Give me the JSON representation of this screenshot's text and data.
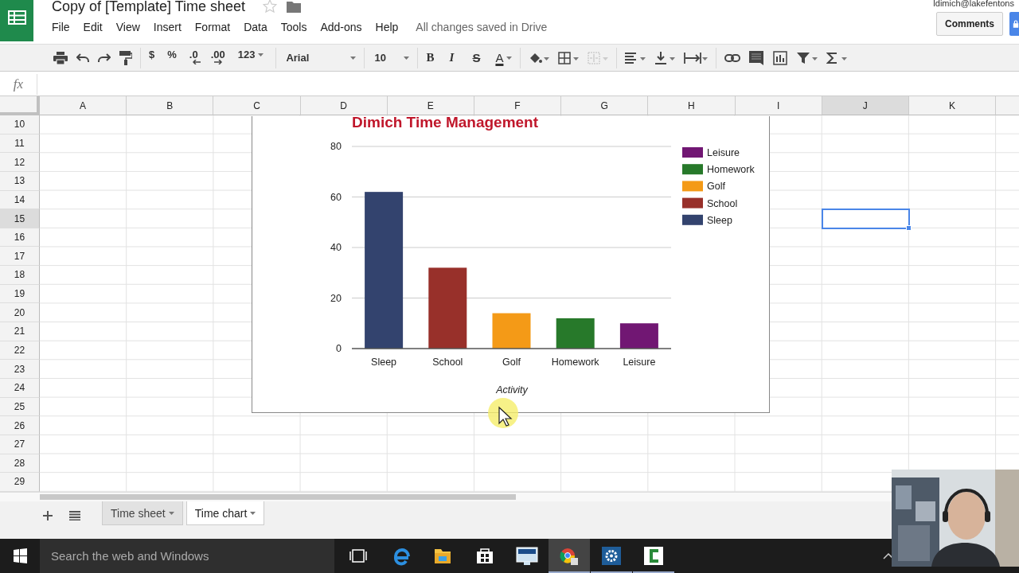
{
  "app": {
    "title": "Copy of [Template] Time sheet",
    "account": "ldimich@lakefentons",
    "save_status": "All changes saved in Drive",
    "comments_button": "Comments"
  },
  "menu": [
    "File",
    "Edit",
    "View",
    "Insert",
    "Format",
    "Data",
    "Tools",
    "Add-ons",
    "Help"
  ],
  "toolbar": {
    "number_formats": [
      "$",
      "%",
      ".0",
      ".00",
      "123"
    ],
    "font": "Arial",
    "font_size": "10",
    "text_styles": [
      "B",
      "I",
      "S",
      "A"
    ]
  },
  "formula_bar": {
    "label": "fx"
  },
  "columns": [
    {
      "label": "A",
      "selected": false
    },
    {
      "label": "B",
      "selected": false
    },
    {
      "label": "C",
      "selected": false
    },
    {
      "label": "D",
      "selected": false
    },
    {
      "label": "E",
      "selected": false
    },
    {
      "label": "F",
      "selected": false
    },
    {
      "label": "G",
      "selected": false
    },
    {
      "label": "H",
      "selected": false
    },
    {
      "label": "I",
      "selected": false
    },
    {
      "label": "J",
      "selected": true
    },
    {
      "label": "K",
      "selected": false
    }
  ],
  "rows": [
    {
      "label": "10",
      "selected": false
    },
    {
      "label": "11",
      "selected": false
    },
    {
      "label": "12",
      "selected": false
    },
    {
      "label": "13",
      "selected": false
    },
    {
      "label": "14",
      "selected": false
    },
    {
      "label": "15",
      "selected": true
    },
    {
      "label": "16",
      "selected": false
    },
    {
      "label": "17",
      "selected": false
    },
    {
      "label": "18",
      "selected": false
    },
    {
      "label": "19",
      "selected": false
    },
    {
      "label": "20",
      "selected": false
    },
    {
      "label": "21",
      "selected": false
    },
    {
      "label": "22",
      "selected": false
    },
    {
      "label": "23",
      "selected": false
    },
    {
      "label": "24",
      "selected": false
    },
    {
      "label": "25",
      "selected": false
    },
    {
      "label": "26",
      "selected": false
    },
    {
      "label": "27",
      "selected": false
    },
    {
      "label": "28",
      "selected": false
    },
    {
      "label": "29",
      "selected": false
    }
  ],
  "chart": {
    "chart_data": {
      "type": "bar",
      "title": "Dimich Time Management",
      "xlabel": "Activity",
      "categories": [
        "Sleep",
        "School",
        "Golf",
        "Homework",
        "Leisure"
      ],
      "stacked": true,
      "grid": true,
      "legend": true,
      "ylim": [
        0,
        80
      ],
      "yticks": [
        0,
        20,
        40,
        60,
        80
      ],
      "series": [
        {
          "name": "Sleep",
          "color": "#33436e",
          "values": [
            62,
            null,
            null,
            null,
            null
          ]
        },
        {
          "name": "School",
          "color": "#98302a",
          "values": [
            null,
            32,
            null,
            null,
            null
          ]
        },
        {
          "name": "Golf",
          "color": "#f49a17",
          "values": [
            null,
            null,
            14,
            null,
            null
          ]
        },
        {
          "name": "Homework",
          "color": "#27792a",
          "values": [
            null,
            null,
            null,
            12,
            null
          ]
        },
        {
          "name": "Leisure",
          "color": "#711773",
          "values": [
            null,
            null,
            null,
            null,
            10
          ]
        }
      ]
    }
  },
  "sheet_tabs": [
    {
      "label": "Time sheet",
      "selected": false
    },
    {
      "label": "Time chart",
      "selected": true
    }
  ],
  "taskbar": {
    "search_placeholder": "Search the web and Windows"
  }
}
